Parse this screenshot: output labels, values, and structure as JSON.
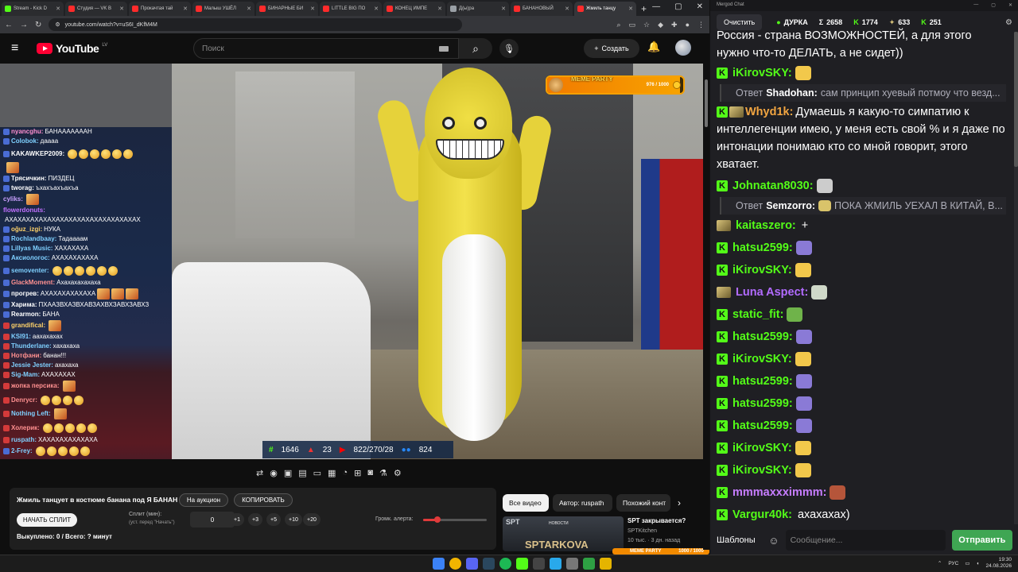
{
  "browser": {
    "tabs": [
      {
        "label": "Stream - Kick D",
        "color": "#53fc18",
        "active": false
      },
      {
        "label": "Студия — VK В",
        "color": "#ff2b2b",
        "active": false
      },
      {
        "label": "Прокачтая тай",
        "color": "#ff2b2b",
        "active": false
      },
      {
        "label": "Малыш УШЁЛ",
        "color": "#ff2b2b",
        "active": false
      },
      {
        "label": "БИНАРНЫЕ БИ",
        "color": "#ff2b2b",
        "active": false
      },
      {
        "label": "LITTLE BIG ПО",
        "color": "#ff2b2b",
        "active": false
      },
      {
        "label": "КОНЕЦ ИМПЕ",
        "color": "#ff2b2b",
        "active": false
      },
      {
        "label": "Д(ы)ра",
        "color": "#9aa0a6",
        "active": false
      },
      {
        "label": "БАНАНОВЫЙ",
        "color": "#ff2b2b",
        "active": false
      },
      {
        "label": "Жмиль танцу",
        "color": "#ff2b2b",
        "active": true
      }
    ],
    "new_tab": "+",
    "url": "youtube.com/watch?v=uS6I_dKfM4M"
  },
  "youtube": {
    "logo_text": "YouTube",
    "country": "LV",
    "search_placeholder": "Поиск",
    "create_label": "Создать"
  },
  "overlay": {
    "meme_party": {
      "label": "MEME PARTY",
      "value_text": "976 / 1000",
      "fraction": 0.976
    },
    "stats": {
      "kick": "1646",
      "rutube": "23",
      "youtube": "822/270/28",
      "vk": "824"
    }
  },
  "left_chat": [
    {
      "nick": "nyancghu:",
      "msg": "БАНАААААААН",
      "color": "#ff8fd0",
      "badge": "#4a6cd4"
    },
    {
      "nick": "Colobok:",
      "msg": "даааа",
      "color": "#7fd0ff",
      "badge": "#4a6cd4"
    },
    {
      "nick": "KAKAWKEP2009:",
      "msg": "",
      "color": "#ffffff",
      "badge": "#4a6cd4",
      "emotes": 6
    },
    {
      "nick": "",
      "msg": "",
      "color": "#ffffff",
      "badge": "",
      "emotes": 1
    },
    {
      "nick": "Трясичкин:",
      "msg": "ПИЗДЕЦ",
      "color": "#ffffff",
      "badge": "#4a6cd4"
    },
    {
      "nick": "tworag:",
      "msg": "ъхахъахъахъа",
      "color": "#ffffff",
      "badge": "#4a6cd4"
    },
    {
      "nick": "cyliks:",
      "msg": "",
      "color": "#c9a0ff",
      "badge": "",
      "emotes": 1
    },
    {
      "nick": "flowerdonuts:",
      "msg": "",
      "color": "#c070ff",
      "badge": ""
    },
    {
      "nick": "",
      "msg": "АХАХАХАХАХАХАХАХАХАХАХАХАХАХАХАХ",
      "color": "#ffffff",
      "badge": ""
    },
    {
      "nick": "oğuz_izgi:",
      "msg": "НУКА",
      "color": "#ffd36a",
      "badge": "#4a6cd4"
    },
    {
      "nick": "Rochlandbaay:",
      "msg": "Тадаааам",
      "color": "#7fd0ff",
      "badge": "#4a6cd4"
    },
    {
      "nick": "Lillyas Music:",
      "msg": "ХАХАХАХА",
      "color": "#7fd0ff",
      "badge": "#4a6cd4"
    },
    {
      "nick": "Аксиологос:",
      "msg": "АХАХАХАХАХА",
      "color": "#7fd0ff",
      "badge": "#4a6cd4"
    },
    {
      "nick": "semoventer:",
      "msg": "",
      "color": "#7fd0ff",
      "badge": "#4a6cd4",
      "emotes": 6
    },
    {
      "nick": "GlackMoment:",
      "msg": "Ахахахахахаха",
      "color": "#ff9090",
      "badge": "#4a6cd4"
    },
    {
      "nick": "прогрев:",
      "msg": "АХАХАХАХАХАХА",
      "color": "#ffffff",
      "badge": "#4a6cd4",
      "emotes": 3
    },
    {
      "nick": "Харима:",
      "msg": "ПХААЗВХАЗВХАВЗАХВХЗАВХЗАВХЗ",
      "color": "#ffffff",
      "badge": "#4a6cd4"
    },
    {
      "nick": "Rearmon:",
      "msg": "БАНА",
      "color": "#ffffff",
      "badge": "#4a6cd4"
    },
    {
      "nick": "grandifical:",
      "msg": "",
      "color": "#ffd36a",
      "badge": "#d43a3a",
      "emotes": 1
    },
    {
      "nick": "KSI91:",
      "msg": "аахахахах",
      "color": "#7fd0ff",
      "badge": "#d43a3a"
    },
    {
      "nick": "Thunderlane:",
      "msg": "хахахаха",
      "color": "#7fd0ff",
      "badge": "#d43a3a"
    },
    {
      "nick": "Нотфани:",
      "msg": "банан!!!",
      "color": "#ff9090",
      "badge": "#d43a3a"
    },
    {
      "nick": "Jessie Jester:",
      "msg": "ахахаха",
      "color": "#7fd0ff",
      "badge": "#d43a3a"
    },
    {
      "nick": "Sig-Mam:",
      "msg": "АХАХАХАХ",
      "color": "#7fd0ff",
      "badge": "#d43a3a"
    },
    {
      "nick": "жопка персика:",
      "msg": "",
      "color": "#ff9090",
      "badge": "#d43a3a",
      "emotes": 1
    },
    {
      "nick": "Denrycr:",
      "msg": "",
      "color": "#ff9090",
      "badge": "#d43a3a",
      "emotes": 4
    },
    {
      "nick": "Nothing Left:",
      "msg": "",
      "color": "#7fd0ff",
      "badge": "#d43a3a",
      "emotes": 1
    },
    {
      "nick": "Холерик:",
      "msg": "",
      "color": "#ff9090",
      "badge": "#d43a3a",
      "emotes": 5
    },
    {
      "nick": "ruspath:",
      "msg": "ХАХАХАХАХАХАХА",
      "color": "#7fd0ff",
      "badge": "#d43a3a"
    },
    {
      "nick": "2-Frey:",
      "msg": "",
      "color": "#7fd0ff",
      "badge": "#4a6cd4",
      "emotes": 5
    }
  ],
  "info": {
    "title": "Жмиль танцует в костюме банана под Я БАНАН",
    "auction_label": "На аукцион",
    "copy_label": "КОПИРОВАТЬ",
    "start_split_label": "НАЧАТЬ СПЛИТ",
    "split_label": "Сплит (мин):",
    "split_hint": "(уст. перед \"Начать\")",
    "split_value": "0",
    "steps": [
      "+1",
      "+3",
      "+5",
      "+10",
      "+20"
    ],
    "volume_label": "Громк. алерта:",
    "volume_fraction": 0.22,
    "bought_text": "Выкуплено: 0 / Всего: ? минут"
  },
  "recs": {
    "tabs": [
      "Все видео",
      "Автор: ruspath",
      "Похожий конт"
    ],
    "video": {
      "title": "SPT закрывается?",
      "channel": "SPTKitchen",
      "meta": "10 тыс. · 3 дн. назад",
      "thumb_top": "SPT",
      "thumb_news": "НОВОСТИ",
      "thumb_big": "SPTARKOVA"
    }
  },
  "mini_meme": {
    "label": "MEME PARTY",
    "value_text": "1000 / 1000"
  },
  "right_chat": {
    "window_title": "Mergod Chat",
    "clear_label": "Очистить",
    "stats": [
      {
        "icon": "●",
        "value": "ДУРКА",
        "color": "#53fc18"
      },
      {
        "icon": "Σ",
        "value": "2658",
        "color": "#ffffff"
      },
      {
        "icon": "K",
        "value": "1774",
        "color": "#53fc18"
      },
      {
        "icon": "✦",
        "value": "633",
        "color": "#d8c37a"
      },
      {
        "icon": "K",
        "value": "251",
        "color": "#53fc18"
      }
    ],
    "messages": [
      {
        "type": "text",
        "text": "Россия - страна ВОЗМОЖНОСТЕЙ, а для этого нужно что-то ДЕЛАТЬ, а не сидет))"
      },
      {
        "type": "msg",
        "badge": "kick",
        "nick": "iKirovSKY:",
        "color": "#53fc18",
        "text": "",
        "emote": "#f2c84b"
      },
      {
        "type": "reply",
        "prefix": "Ответ",
        "nick": "Shadohan:",
        "text": "сам принцип хуевый потмоу что везд..."
      },
      {
        "type": "wrap",
        "badge": "kick2",
        "nick": "Whyd1k:",
        "color": "#f2a541",
        "text": "Думаешь я какую-то симпатию к интеллегенции имею, у меня есть свой % и я даже по интонации понимаю кто со мной говорит, этого хватает."
      },
      {
        "type": "msg",
        "badge": "kick",
        "nick": "Johnatan8030:",
        "color": "#53fc18",
        "text": "",
        "emote": "#cccccc"
      },
      {
        "type": "reply",
        "prefix": "Ответ",
        "nick": "Semzorro:",
        "text": "ПОКА ЖМИЛЬ УЕХАЛ В КИТАЙ, В..."
      },
      {
        "type": "msg",
        "badge": "vip",
        "nick": "kaitaszero:",
        "color": "#53fc18",
        "text": "+",
        "emote": ""
      },
      {
        "type": "msg",
        "badge": "kick",
        "nick": "hatsu2599:",
        "color": "#53fc18",
        "text": "",
        "emote": "#8a7ad6"
      },
      {
        "type": "msg",
        "badge": "kick",
        "nick": "iKirovSKY:",
        "color": "#53fc18",
        "text": "",
        "emote": "#f2c84b"
      },
      {
        "type": "msg",
        "badge": "vip",
        "nick": "Luna Aspect:",
        "color": "#b26bff",
        "text": "",
        "emote": "#cfd8c8"
      },
      {
        "type": "msg",
        "badge": "kick",
        "nick": "static_fit:",
        "color": "#53fc18",
        "text": "",
        "emote": "#6fb34a"
      },
      {
        "type": "msg",
        "badge": "kick",
        "nick": "hatsu2599:",
        "color": "#53fc18",
        "text": "",
        "emote": "#8a7ad6"
      },
      {
        "type": "msg",
        "badge": "kick",
        "nick": "iKirovSKY:",
        "color": "#53fc18",
        "text": "",
        "emote": "#f2c84b"
      },
      {
        "type": "msg",
        "badge": "kick",
        "nick": "hatsu2599:",
        "color": "#53fc18",
        "text": "",
        "emote": "#8a7ad6"
      },
      {
        "type": "msg",
        "badge": "kick",
        "nick": "hatsu2599:",
        "color": "#53fc18",
        "text": "",
        "emote": "#8a7ad6"
      },
      {
        "type": "msg",
        "badge": "kick",
        "nick": "hatsu2599:",
        "color": "#53fc18",
        "text": "",
        "emote": "#8a7ad6"
      },
      {
        "type": "msg",
        "badge": "kick",
        "nick": "iKirovSKY:",
        "color": "#53fc18",
        "text": "",
        "emote": "#f2c84b"
      },
      {
        "type": "msg",
        "badge": "kick",
        "nick": "iKirovSKY:",
        "color": "#53fc18",
        "text": "",
        "emote": "#f2c84b"
      },
      {
        "type": "msg",
        "badge": "kick",
        "nick": "mmmaxxximmm:",
        "color": "#c77dff",
        "text": "",
        "emote": "#b5553a"
      },
      {
        "type": "msg",
        "badge": "kick",
        "nick": "Vargur40k:",
        "color": "#53fc18",
        "text": "ахахахах)",
        "emote": ""
      }
    ],
    "templates_label": "Шаблоны",
    "input_placeholder": "Сообщение...",
    "send_label": "Отправить"
  },
  "taskbar": {
    "lang": "РУС",
    "time": "19:30",
    "date": "24.08.2026"
  }
}
